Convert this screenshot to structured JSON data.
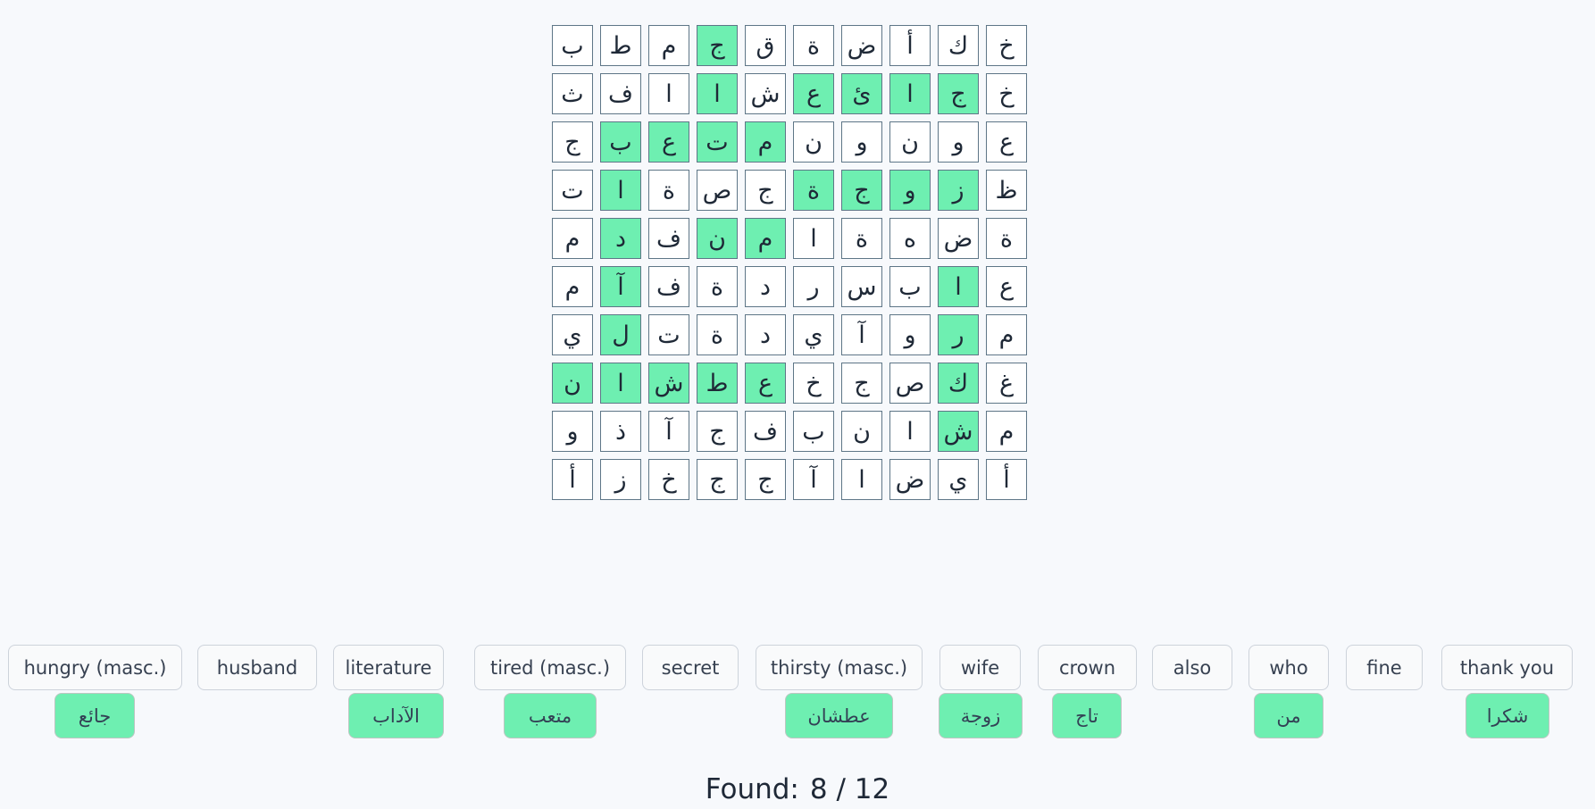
{
  "grid": {
    "rows": [
      [
        "خ",
        "ك",
        "أ",
        "ض",
        "ة",
        "ق",
        "ج",
        "م",
        "ط",
        "ب"
      ],
      [
        "خ",
        "ج",
        "ا",
        "ئ",
        "ع",
        "ش",
        "ا",
        "ا",
        "ف",
        "ث"
      ],
      [
        "ع",
        "و",
        "ن",
        "و",
        "ن",
        "م",
        "ت",
        "ع",
        "ب",
        "ج"
      ],
      [
        "ظ",
        "ز",
        "و",
        "ج",
        "ة",
        "ج",
        "ص",
        "ة",
        "ا",
        "ت"
      ],
      [
        "ة",
        "ض",
        "ه",
        "ة",
        "ا",
        "م",
        "ن",
        "ف",
        "د",
        "م"
      ],
      [
        "ع",
        "ا",
        "ب",
        "س",
        "ر",
        "د",
        "ة",
        "ف",
        "آ",
        "م"
      ],
      [
        "م",
        "ر",
        "و",
        "آ",
        "ي",
        "د",
        "ة",
        "ت",
        "ل",
        "ي"
      ],
      [
        "غ",
        "ك",
        "ص",
        "ج",
        "خ",
        "ع",
        "ط",
        "ش",
        "ا",
        "ن"
      ],
      [
        "م",
        "ش",
        "ا",
        "ن",
        "ب",
        "ف",
        "ج",
        "آ",
        "ذ",
        "و"
      ],
      [
        "أ",
        "ي",
        "ض",
        "ا",
        "آ",
        "ج",
        "ج",
        "خ",
        "ز",
        "أ"
      ]
    ],
    "highlighted": [
      [
        0,
        6
      ],
      [
        1,
        1
      ],
      [
        1,
        2
      ],
      [
        1,
        3
      ],
      [
        1,
        4
      ],
      [
        1,
        6
      ],
      [
        2,
        5
      ],
      [
        2,
        6
      ],
      [
        2,
        7
      ],
      [
        2,
        8
      ],
      [
        3,
        1
      ],
      [
        3,
        2
      ],
      [
        3,
        3
      ],
      [
        3,
        4
      ],
      [
        3,
        8
      ],
      [
        4,
        5
      ],
      [
        4,
        6
      ],
      [
        4,
        8
      ],
      [
        5,
        1
      ],
      [
        5,
        8
      ],
      [
        6,
        1
      ],
      [
        6,
        8
      ],
      [
        7,
        1
      ],
      [
        7,
        5
      ],
      [
        7,
        6
      ],
      [
        7,
        7
      ],
      [
        7,
        8
      ],
      [
        7,
        9
      ],
      [
        8,
        1
      ]
    ],
    "highlight_color": "#6eefb1"
  },
  "words": [
    {
      "clue": "hungry (masc.)",
      "answer": "جائع"
    },
    {
      "clue": "husband",
      "answer": ""
    },
    {
      "clue": "literature",
      "answer": "الآداب"
    },
    {
      "clue": "tired (masc.)",
      "answer": "متعب"
    },
    {
      "clue": "secret",
      "answer": ""
    },
    {
      "clue": "thirsty (masc.)",
      "answer": "عطشان"
    },
    {
      "clue": "wife",
      "answer": "زوجة"
    },
    {
      "clue": "crown",
      "answer": "تاج"
    },
    {
      "clue": "also",
      "answer": ""
    },
    {
      "clue": "who",
      "answer": "من"
    },
    {
      "clue": "fine",
      "answer": ""
    },
    {
      "clue": "thank you",
      "answer": "شكرا"
    }
  ],
  "status": {
    "label": "Found:",
    "found": "8",
    "separator": "/",
    "total": "12"
  }
}
